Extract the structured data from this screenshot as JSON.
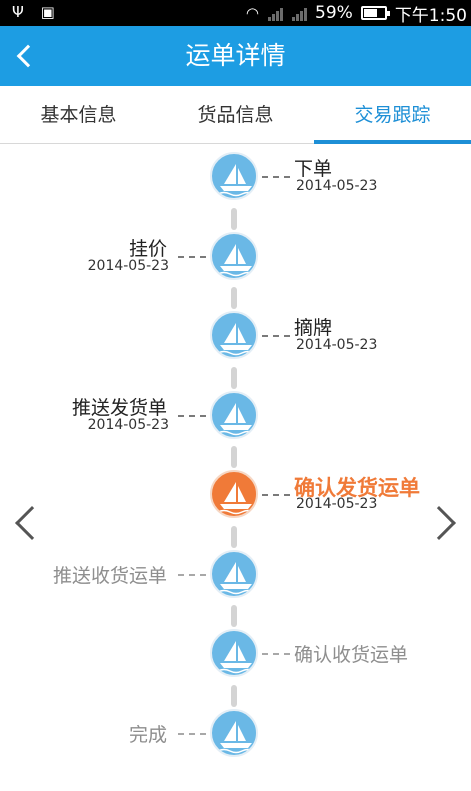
{
  "status_bar": {
    "usb_icon": "usb-icon",
    "android_icon": "android-debug-icon",
    "battery_percent": "59%",
    "time": "下午1:50",
    "sim1": "1",
    "sim2": "2"
  },
  "header": {
    "title": "运单详情",
    "background": "#1d9de3"
  },
  "tabs": [
    {
      "label": "基本信息",
      "selected": false
    },
    {
      "label": "货品信息",
      "selected": false
    },
    {
      "label": "交易跟踪",
      "selected": true
    }
  ],
  "timeline": [
    {
      "label": "下单",
      "date": "2014-05-23",
      "side": "right",
      "state": "done"
    },
    {
      "label": "挂价",
      "date": "2014-05-23",
      "side": "left",
      "state": "done"
    },
    {
      "label": "摘牌",
      "date": "2014-05-23",
      "side": "right",
      "state": "done"
    },
    {
      "label": "推送发货单",
      "date": "2014-05-23",
      "side": "left",
      "state": "done"
    },
    {
      "label": "确认发货运单",
      "date": "2014-05-23",
      "side": "right",
      "state": "current"
    },
    {
      "label": "推送收货运单",
      "date": "",
      "side": "left",
      "state": "pending"
    },
    {
      "label": "确认收货运单",
      "date": "",
      "side": "right",
      "state": "pending"
    },
    {
      "label": "完成",
      "date": "",
      "side": "left",
      "state": "pending"
    }
  ],
  "colors": {
    "accent": "#1d8fd6",
    "node_done": "#6ab8e6",
    "node_current": "#f07a38",
    "pending_text": "#8e8e8e"
  }
}
